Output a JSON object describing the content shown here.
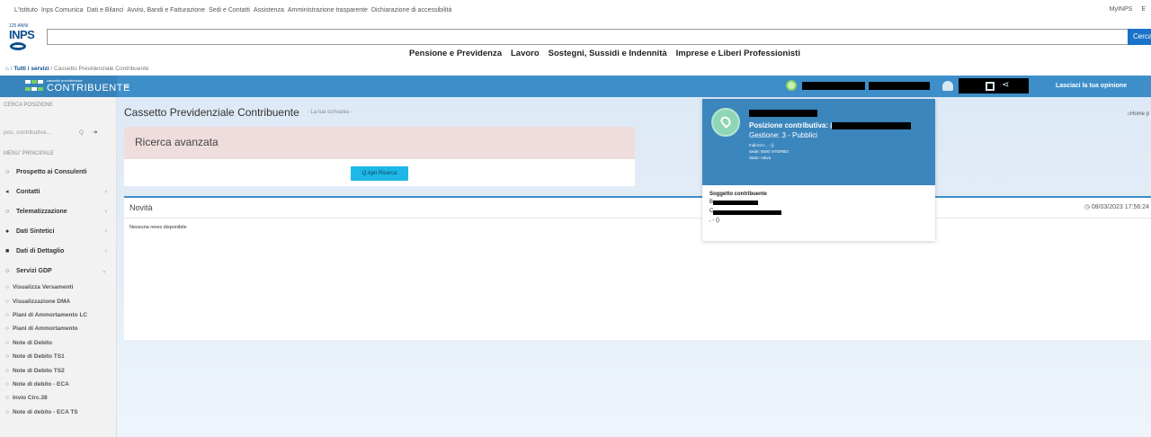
{
  "topnav": {
    "links": [
      "L'Istituto",
      "Inps Comunica",
      "Dati e Bilanci",
      "Avvisi, Bandi e Fatturazione",
      "Sedi e Contatti",
      "Assistenza",
      "Amministrazione trasparente",
      "Dichiarazione di accessibilità"
    ],
    "right": [
      "MyINPS",
      "E"
    ]
  },
  "logo": {
    "top": "125 ANNI",
    "name": "INPS"
  },
  "search": {
    "button": "Cerca"
  },
  "mainnav": [
    "Pensione e Previdenza",
    "Lavoro",
    "Sostegni, Sussidi e Indennità",
    "Imprese e Liberi Professionisti"
  ],
  "breadcrumb": {
    "home": "⌂",
    "sep1": " / ",
    "all": "Tutti i servizi",
    "sep2": " / ",
    "current": "Cassetto Previdenziale Contribuente"
  },
  "appbar": {
    "brand_small": "cassetto previdenziale",
    "brand_name": "CONTRIBUENTE",
    "menu": "≡",
    "share": "⋖",
    "opinion": "Lasciaci la tua opinione"
  },
  "sidebar": {
    "search_label": "CERCA POSIZIONE",
    "search_placeholder": "pos. contributiva...",
    "menu_label": "MENU' PRINCIPALE",
    "items": [
      {
        "icon": "○",
        "label": "Prospetto ai Consulenti",
        "chev": ""
      },
      {
        "icon": "◂",
        "label": "Contatti",
        "chev": "‹"
      },
      {
        "icon": "○",
        "label": "Telematizzazione",
        "chev": "‹"
      },
      {
        "icon": "●",
        "label": "Dati Sintetici",
        "chev": "‹"
      },
      {
        "icon": "■",
        "label": "Dati di Dettaglio",
        "chev": "‹"
      },
      {
        "icon": "○",
        "label": "Servizi GDP",
        "chev": "⌄"
      }
    ],
    "subitems": [
      "Visualizza Versamenti",
      "Visualizzazione DMA",
      "Piani di Ammortamento LC",
      "Piani di Ammortamento",
      "Note di Debito",
      "Note di Debito TS1",
      "Note di Debito TS2",
      "Note di debito - ECA",
      "Invio Circ.38",
      "Note di debito - ECA TS"
    ]
  },
  "content": {
    "title": "Cassetto Previdenziale Contribuente",
    "subtitle": "- La tua scrivania -",
    "home_link": "⌂Home p",
    "advanced_title": "Ricerca avanzata",
    "advanced_button": "Q Apri Ricerca",
    "news_title": "Novità",
    "news_time": "◷ 08/03/2023 17:56:24",
    "news_empty": "Nessuna news disponibile"
  },
  "popup": {
    "position_label": "Posizione contributiva: (",
    "gestione": "Gestione: 3 - Pubblici",
    "info": [
      "Indirizzo: , - ()",
      "Sede: 9200 VITERBO",
      "Stato: Attiva"
    ],
    "subject_title": "Soggetto contribuente",
    "row_b": "B",
    "row_c": "C",
    "row_last": ", - ()"
  },
  "colors": {
    "appbar": "#3d8ec9",
    "accent": "#1eb8e8",
    "advanced_bg": "#efdcdc",
    "popup_head": "#3b86bd"
  }
}
